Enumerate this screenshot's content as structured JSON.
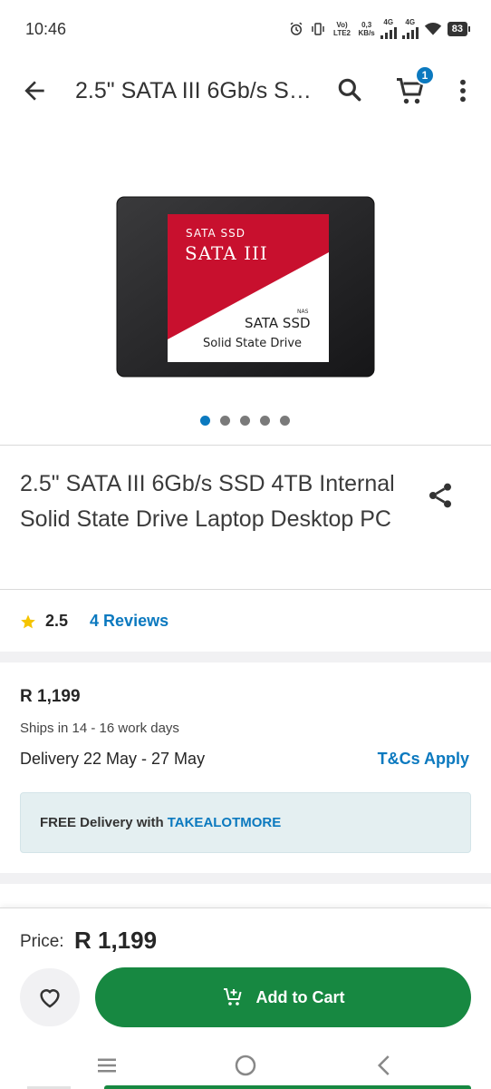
{
  "status_bar": {
    "time": "10:46",
    "volte": "Vo) LTE2",
    "speed_value": "0,3",
    "speed_unit": "KB/s",
    "net1": "4G",
    "net2": "4G",
    "battery": "83"
  },
  "app_bar": {
    "title": "2.5\" SATA III 6Gb/s SSD 4TB Internal Solid State Drive Laptop Desktop PC",
    "cart_count": "1"
  },
  "product_image": {
    "label_top_small": "SATA SSD",
    "label_top_big": "SATA III",
    "label_nas": "NAS",
    "label_bottom_big": "SATA SSD",
    "label_bottom_small": "Solid State Drive"
  },
  "carousel": {
    "total": 5,
    "active_index": 0
  },
  "product": {
    "title": "2.5\" SATA III 6Gb/s SSD 4TB Internal Solid State Drive Laptop Desktop PC",
    "rating": "2.5",
    "reviews": "4 Reviews"
  },
  "pricing": {
    "price": "R 1,199",
    "ships": "Ships in 14 - 16 work days",
    "delivery": "Delivery 22 May - 27 May",
    "tcs": "T&Cs Apply",
    "promo_text": "FREE Delivery with",
    "promo_code": "TAKEALOTMORE"
  },
  "bottom_bar": {
    "price_label": "Price:",
    "price": "R 1,199",
    "add_to_cart": "Add to Cart"
  },
  "colors": {
    "accent_blue": "#0b79bf",
    "cta_green": "#178841",
    "promo_bg": "#e4eff1",
    "star": "#f5c400"
  },
  "icons": [
    "back-arrow-icon",
    "search-icon",
    "cart-icon",
    "more-vert-icon",
    "share-icon",
    "star-icon",
    "heart-icon",
    "add-to-cart-icon",
    "nav-menu-icon",
    "nav-home-icon",
    "nav-back-icon"
  ]
}
